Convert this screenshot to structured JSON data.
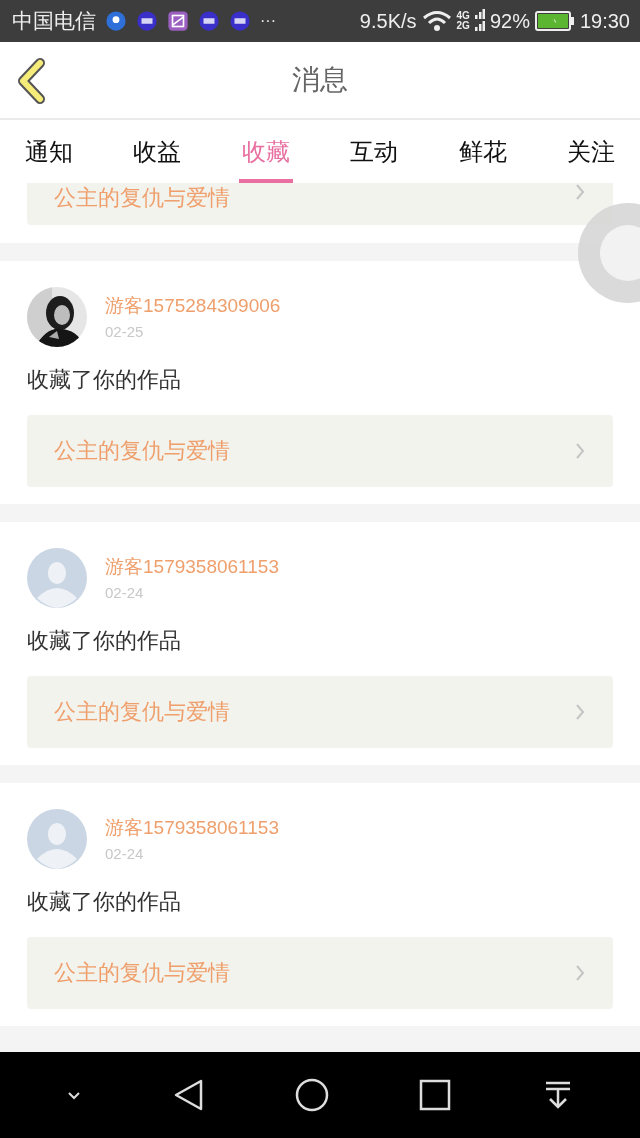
{
  "status_bar": {
    "carrier": "中国电信",
    "more": "···",
    "speed": "9.5K/s",
    "network_top": "4G",
    "network_bottom": "2G",
    "battery": "92%",
    "time": "19:30"
  },
  "header": {
    "title": "消息"
  },
  "tabs": [
    {
      "label": "通知",
      "selected": false
    },
    {
      "label": "收益",
      "selected": false
    },
    {
      "label": "收藏",
      "selected": true
    },
    {
      "label": "互动",
      "selected": false
    },
    {
      "label": "鲜花",
      "selected": false
    },
    {
      "label": "关注",
      "selected": false
    }
  ],
  "messages": [
    {
      "kind": "partial",
      "work": "公主的复仇与爱情"
    },
    {
      "kind": "full",
      "user": "游客1575284309006",
      "date": "02-25",
      "action": "收藏了你的作品",
      "work": "公主的复仇与爱情"
    },
    {
      "kind": "full",
      "avatar": {
        "kind": "default"
      },
      "user": "游客1579358061153",
      "date": "02-24",
      "action": "收藏了你的作品",
      "work": "公主的复仇与爱情"
    },
    {
      "kind": "full",
      "avatar": {
        "kind": "default"
      },
      "user": "游客1579358061153",
      "date": "02-24",
      "action": "收藏了你的作品",
      "work": "公主的复仇与爱情"
    }
  ]
}
